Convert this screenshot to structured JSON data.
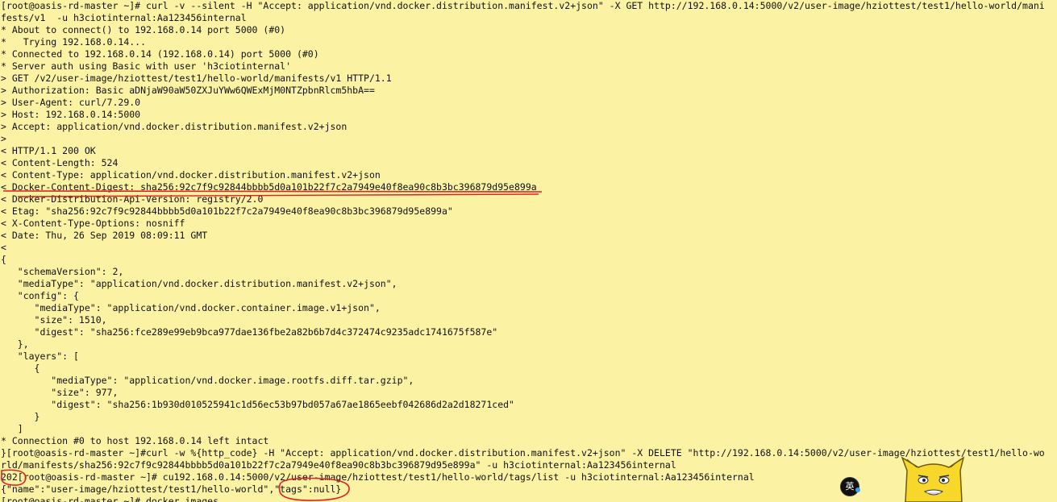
{
  "terminal": {
    "background_color": "#fbf2a4",
    "text_color": "#111111",
    "annotation_color": "#e02020",
    "lines": [
      "[root@oasis-rd-master ~]# curl -v --silent -H \"Accept: application/vnd.docker.distribution.manifest.v2+json\" -X GET http://192.168.0.14:5000/v2/user-image/hziottest/test1/hello-world/mani",
      "fests/v1  -u h3ciotinternal:Aa123456internal",
      "* About to connect() to 192.168.0.14 port 5000 (#0)",
      "*   Trying 192.168.0.14...",
      "* Connected to 192.168.0.14 (192.168.0.14) port 5000 (#0)",
      "* Server auth using Basic with user 'h3ciotinternal'",
      "> GET /v2/user-image/hziottest/test1/hello-world/manifests/v1 HTTP/1.1",
      "> Authorization: Basic aDNjaW90aW50ZXJuYWw6QWExMjM0NTZpbnRlcm5hbA==",
      "> User-Agent: curl/7.29.0",
      "> Host: 192.168.0.14:5000",
      "> Accept: application/vnd.docker.distribution.manifest.v2+json",
      ">",
      "< HTTP/1.1 200 OK",
      "< Content-Length: 524",
      "< Content-Type: application/vnd.docker.distribution.manifest.v2+json",
      "< Docker-Content-Digest: sha256:92c7f9c92844bbbb5d0a101b22f7c2a7949e40f8ea90c8b3bc396879d95e899a",
      "< Docker-Distribution-Api-Version: registry/2.0",
      "< Etag: \"sha256:92c7f9c92844bbbb5d0a101b22f7c2a7949e40f8ea90c8b3bc396879d95e899a\"",
      "< X-Content-Type-Options: nosniff",
      "< Date: Thu, 26 Sep 2019 08:09:11 GMT",
      "<",
      "{",
      "   \"schemaVersion\": 2,",
      "   \"mediaType\": \"application/vnd.docker.distribution.manifest.v2+json\",",
      "   \"config\": {",
      "      \"mediaType\": \"application/vnd.docker.container.image.v1+json\",",
      "      \"size\": 1510,",
      "      \"digest\": \"sha256:fce289e99eb9bca977dae136fbe2a82b6b7d4c372474c9235adc1741675f587e\"",
      "   },",
      "   \"layers\": [",
      "      {",
      "         \"mediaType\": \"application/vnd.docker.image.rootfs.diff.tar.gzip\",",
      "         \"size\": 977,",
      "         \"digest\": \"sha256:1b930d010525941c1d56ec53b97bd057a67ae1865eebf042686d2a2d18271ced\"",
      "      }",
      "   ]",
      "* Connection #0 to host 192.168.0.14 left intact",
      "}[root@oasis-rd-master ~]#curl -w %{http_code} -H \"Accept: application/vnd.docker.distribution.manifest.v2+json\" -X DELETE \"http://192.168.0.14:5000/v2/user-image/hziottest/test1/hello-wo",
      "rld/manifests/sha256:92c7f9c92844bbbb5d0a101b22f7c2a7949e40f8ea90c8b3bc396879d95e899a\" -u h3ciotinternal:Aa123456internal",
      "202[root@oasis-rd-master ~]# cu192.168.0.14:5000/v2/user-image/hziottest/test1/hello-world/tags/list -u h3ciotinternal:Aa123456internal",
      "{\"name\":\"user-image/hziottest/test1/hello-world\",\"tags\":null}",
      "[root@oasis-rd-master ~]# docker images"
    ]
  },
  "overlays": {
    "ime_indicator_label": "英",
    "ime_indicator_color": "#111111",
    "ime_accent_color": "#3aa0ff",
    "mascot_icon": "yellow-cat-mascot-icon",
    "mascot_color": "#f7d82a"
  }
}
